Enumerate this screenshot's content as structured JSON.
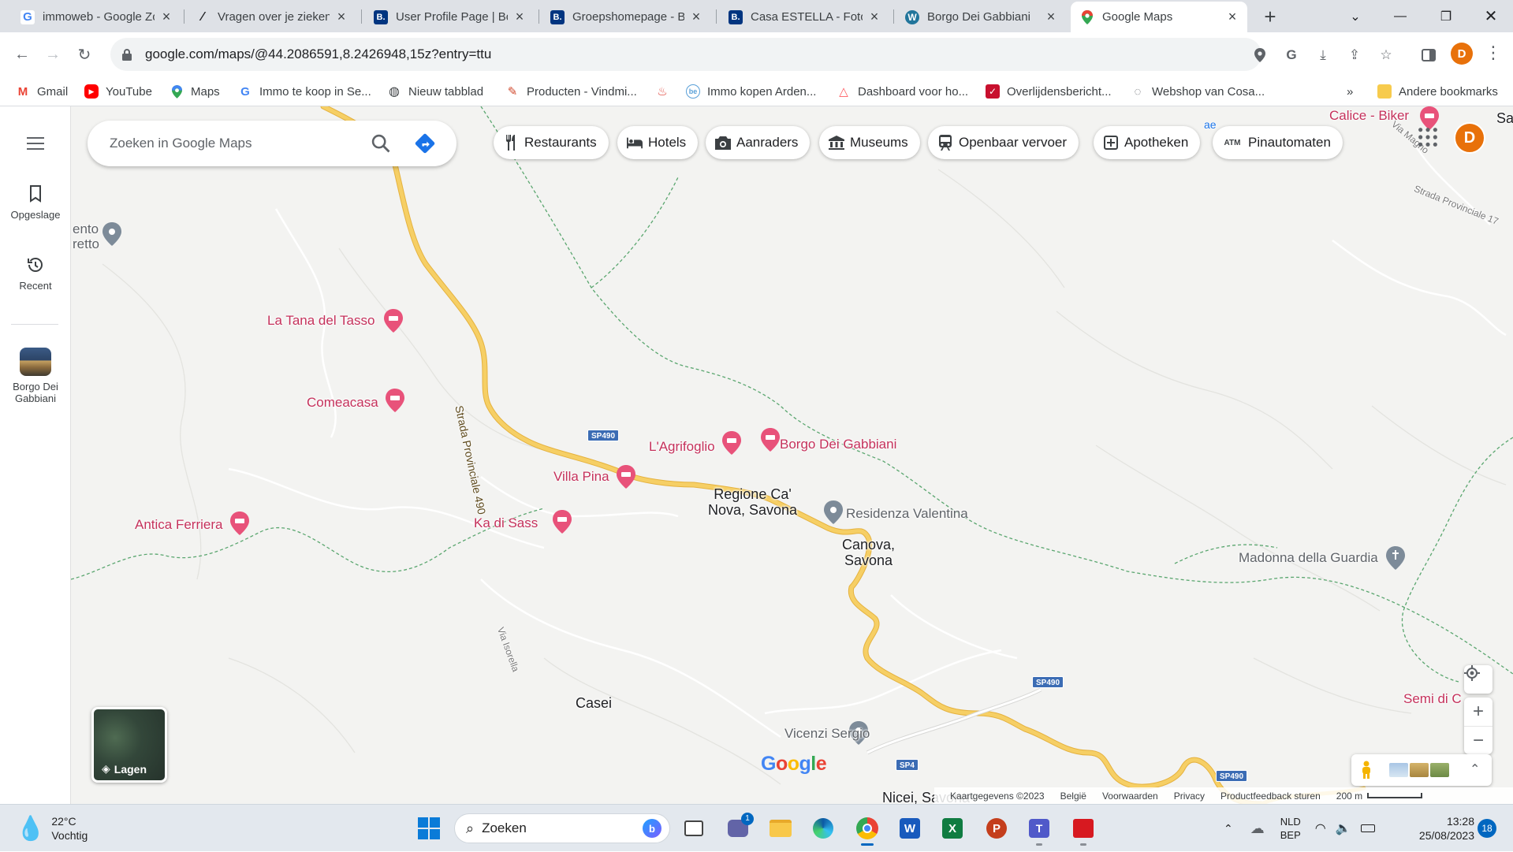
{
  "browser": {
    "tabs": [
      {
        "title": "immoweb - Google Zo",
        "favicon": "google-icon",
        "color": "#4285f4",
        "active": false
      },
      {
        "title": "Vragen over je ziekenh",
        "favicon": "feather-icon",
        "color": "#202124",
        "active": false
      },
      {
        "title": "User Profile Page | Bo",
        "favicon": "booking-icon",
        "color": "#003580",
        "active": false
      },
      {
        "title": "Groepshomepage - Bo",
        "favicon": "booking-icon",
        "color": "#003580",
        "active": false
      },
      {
        "title": "Casa ESTELLA - Foto's",
        "favicon": "booking-icon",
        "color": "#003580",
        "active": false
      },
      {
        "title": "Borgo Dei Gabbiani",
        "favicon": "wordpress-icon",
        "color": "#21759b",
        "active": false
      },
      {
        "title": "Google Maps",
        "favicon": "maps-pin-icon",
        "color": "#34a853",
        "active": true
      }
    ],
    "url": "google.com/maps/@44.2086591,8.2426948,15z?entry=ttu",
    "profile_initial": "D",
    "bookmarks": [
      {
        "label": "Gmail",
        "icon": "gmail-icon"
      },
      {
        "label": "YouTube",
        "icon": "youtube-icon"
      },
      {
        "label": "Maps",
        "icon": "maps-pin-icon"
      },
      {
        "label": "Immo te koop in Se...",
        "icon": "google-icon"
      },
      {
        "label": "Nieuw tabblad",
        "icon": "globe-icon"
      },
      {
        "label": "Producten - Vindmi...",
        "icon": "broom-icon"
      },
      {
        "label": "",
        "icon": "flame-icon"
      },
      {
        "label": "Immo kopen Arden...",
        "icon": "be-icon"
      },
      {
        "label": "Dashboard voor ho...",
        "icon": "airbnb-icon"
      },
      {
        "label": "Overlijdensbericht...",
        "icon": "check-icon"
      },
      {
        "label": "Webshop van Cosa...",
        "icon": "loading-icon"
      }
    ],
    "more_bookmarks": "»",
    "other_bookmarks": "Andere bookmarks"
  },
  "maps": {
    "search_placeholder": "Zoeken in Google Maps",
    "rail": {
      "saved": "Opgeslage",
      "recent": "Recent",
      "recent_place_line1": "Borgo Dei",
      "recent_place_line2": "Gabbiani"
    },
    "chips": [
      {
        "label": "Restaurants",
        "icon": "fork-knife-icon"
      },
      {
        "label": "Hotels",
        "icon": "bed-icon"
      },
      {
        "label": "Aanraders",
        "icon": "camera-icon"
      },
      {
        "label": "Museums",
        "icon": "museum-icon"
      },
      {
        "label": "Openbaar vervoer",
        "icon": "transit-icon"
      },
      {
        "label": "Apotheken",
        "icon": "pharmacy-icon"
      },
      {
        "label": "Pinautomaten",
        "icon": "atm-icon"
      }
    ],
    "account_initial": "D",
    "labels": {
      "la_tana": "La Tana del Tasso",
      "comeacasa": "Comeacasa",
      "agrifoglio": "L'Agrifoglio",
      "borgo": "Borgo Dei Gabbiani",
      "villa_pina": "Villa Pina",
      "ka_di_sass": "Ka di Sass",
      "antica": "Antica Ferriera",
      "regione_1": "Regione Ca'",
      "regione_2": "Nova, Savona",
      "residenza": "Residenza Valentina",
      "canova_1": "Canova,",
      "canova_2": "Savona",
      "madonna": "Madonna della Guardia",
      "casei": "Casei",
      "vicenzi": "Vicenzi Sergio",
      "nicei": "Nicei, Savona",
      "semi": "Semi di C",
      "calice": "Calice - Biker",
      "savona_edge": "Savona",
      "ento": "ento",
      "retto": "retto",
      "ae": "ae",
      "via_magno": "Via Magno",
      "strada_prov_17": "Strada Provinciale 17",
      "strada_prov_490": "Strada Provinciale 490",
      "via_isorella": "Via Isorella"
    },
    "shields": [
      "SP490",
      "SP490",
      "SP490",
      "SP4"
    ],
    "layers_label": "Lagen",
    "google_logo": "Google",
    "attribution": [
      "Kaartgegevens ©2023",
      "België",
      "Voorwaarden",
      "Privacy",
      "Productfeedback sturen",
      "200 m"
    ],
    "colors": {
      "road_yellow": "#f6cf65",
      "road_outline": "#e5b23f",
      "poi_pink": "#c5315b",
      "boundary_green": "#5aa66f",
      "shield_blue": "#3b6cb4"
    }
  },
  "taskbar": {
    "weather_temp": "22°C",
    "weather_desc": "Vochtig",
    "search_label": "Zoeken",
    "lang_1": "NLD",
    "lang_2": "BEP",
    "time": "13:28",
    "date": "25/08/2023",
    "notifications": "18",
    "teams_badge": "1"
  }
}
